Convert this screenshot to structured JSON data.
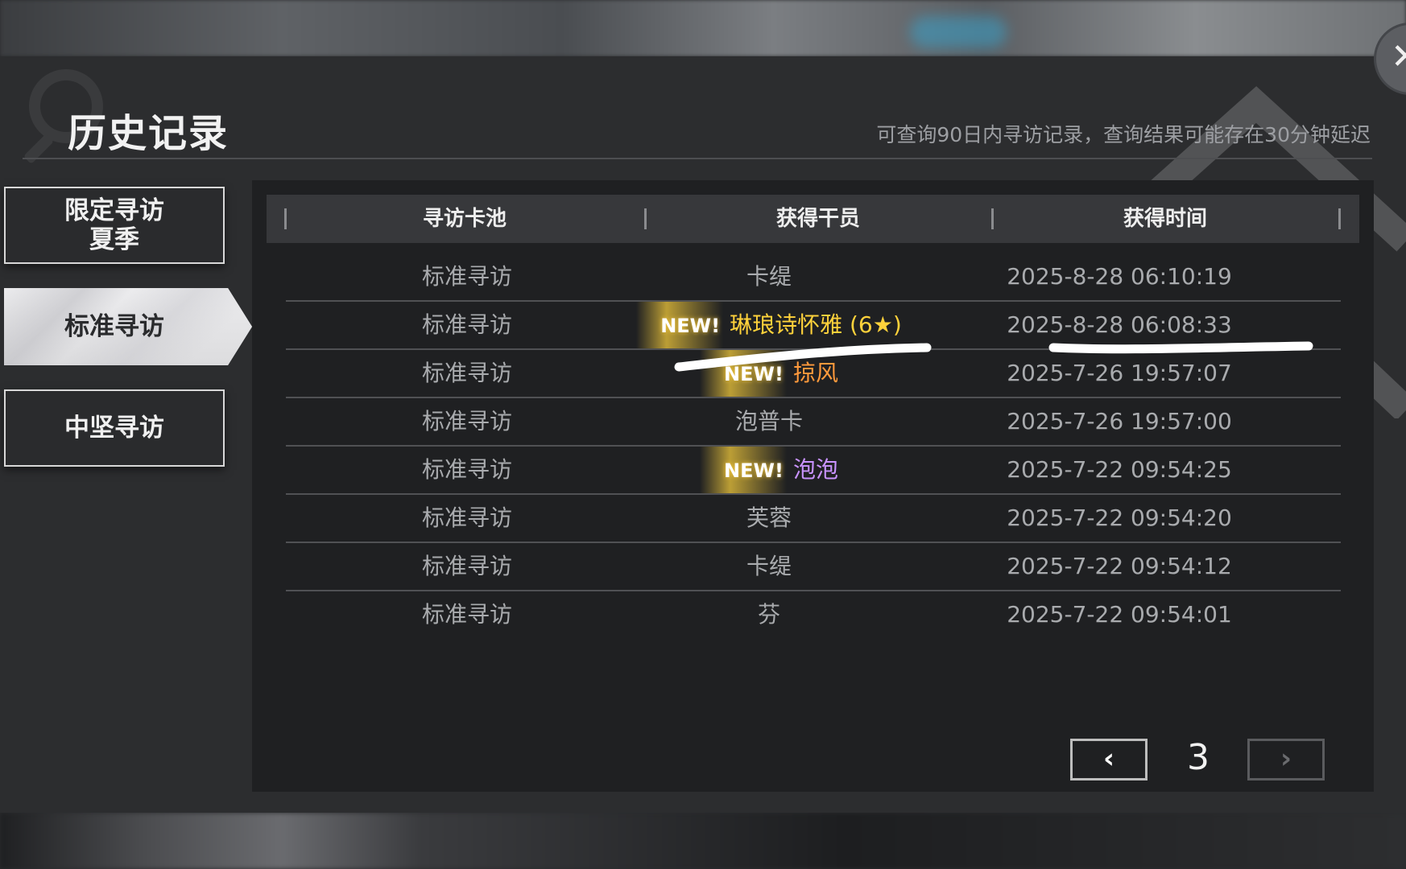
{
  "header": {
    "title": "历史记录",
    "subtitle": "可查询90日内寻访记录，查询结果可能存在30分钟延迟",
    "close_icon": "close-icon"
  },
  "sidebar": {
    "items": [
      {
        "label_line1": "限定寻访",
        "label_line2": "夏季",
        "active": false
      },
      {
        "label": "标准寻访",
        "active": true
      },
      {
        "label": "中坚寻访",
        "active": false
      }
    ]
  },
  "table": {
    "columns": [
      "寻访卡池",
      "获得干员",
      "获得时间"
    ],
    "rows": [
      {
        "pool": "标准寻访",
        "new": "",
        "operator": "卡缇",
        "time": "2025-8-28 06:10:19",
        "rarity": ""
      },
      {
        "pool": "标准寻访",
        "new": "NEW!",
        "operator": "琳琅诗怀雅 (6★)",
        "time": "2025-8-28 06:08:33",
        "rarity": "6"
      },
      {
        "pool": "标准寻访",
        "new": "NEW!",
        "operator": "掠风",
        "time": "2025-7-26 19:57:07",
        "rarity": "5"
      },
      {
        "pool": "标准寻访",
        "new": "",
        "operator": "泡普卡",
        "time": "2025-7-26 19:57:00",
        "rarity": ""
      },
      {
        "pool": "标准寻访",
        "new": "NEW!",
        "operator": "泡泡",
        "time": "2025-7-22 09:54:25",
        "rarity": "4"
      },
      {
        "pool": "标准寻访",
        "new": "",
        "operator": "芙蓉",
        "time": "2025-7-22 09:54:20",
        "rarity": ""
      },
      {
        "pool": "标准寻访",
        "new": "",
        "operator": "卡缇",
        "time": "2025-7-22 09:54:12",
        "rarity": ""
      },
      {
        "pool": "标准寻访",
        "new": "",
        "operator": "芬",
        "time": "2025-7-22 09:54:01",
        "rarity": ""
      }
    ]
  },
  "pager": {
    "prev_icon": "chevron-left-icon",
    "next_icon": "chevron-right-icon",
    "prev_glyph": "‹",
    "next_glyph": "›",
    "page": "3"
  },
  "colors": {
    "rarity_6": "#ffd23b",
    "rarity_5": "#ff9a3c",
    "rarity_4": "#c993ff",
    "accent_white": "#e8e8ea"
  }
}
